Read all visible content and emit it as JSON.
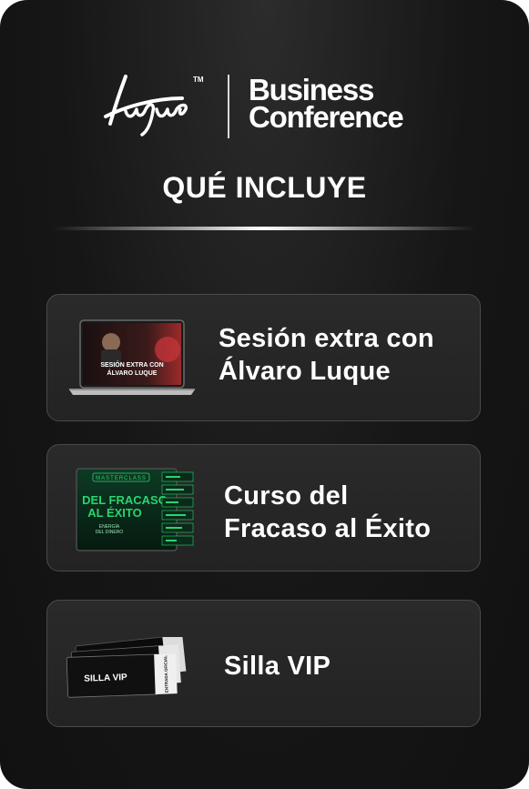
{
  "brand": {
    "logo_script": "Luque",
    "trademark": "TM",
    "name_line1": "Business",
    "name_line2": "Conference"
  },
  "section": {
    "title": "QUÉ INCLUYE"
  },
  "items": [
    {
      "label_line1": "Sesión extra con",
      "label_line2": "Álvaro Luque",
      "thumb_caption_line1": "SESIÓN EXTRA CON",
      "thumb_caption_line2": "ÁLVARO LUQUE"
    },
    {
      "label_line1": "Curso del",
      "label_line2": "Fracaso al Éxito",
      "thumb_kicker": "MASTERCLASS",
      "thumb_title_line1": "DEL FRACASO",
      "thumb_title_line2": "AL ÉXITO",
      "thumb_sub_line1": "ENERGÍA",
      "thumb_sub_line2": "DEL DINERO"
    },
    {
      "label_line1": "Silla VIP",
      "thumb_ticket_text": "SILLA VIP",
      "thumb_stub_text": "ENTRADA OFICIAL"
    }
  ],
  "colors": {
    "background": "#161616",
    "card_border": "#4a4a4a",
    "text": "#ffffff",
    "accent_green": "#2bd46f"
  }
}
